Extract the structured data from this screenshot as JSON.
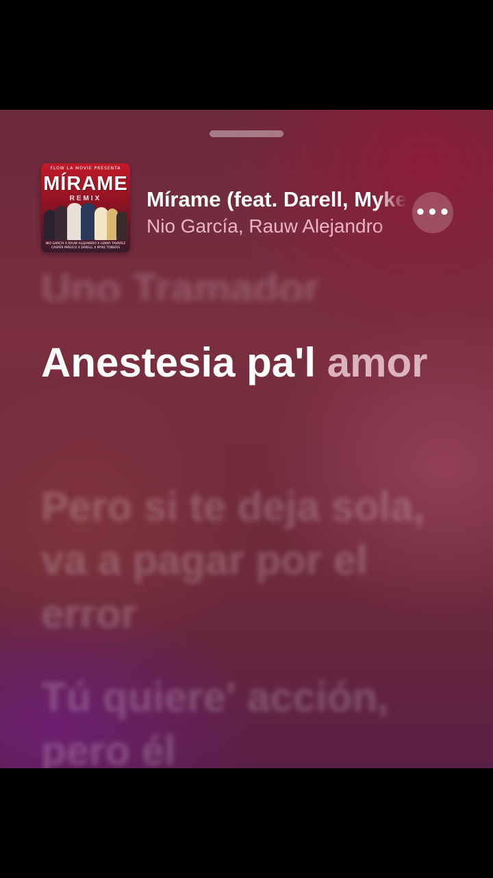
{
  "now_playing": {
    "title": "Mírame (feat. Darell, Myke Towers)",
    "artist": "Nio García, Rauw Alejandro",
    "artwork": {
      "top_line": "FLOW LA MOVIE PRESENTA",
      "title": "MÍRAME",
      "subtitle": "REMIX",
      "credits": "NIO GARCÍA X RAUW ALEJANDRO X LENNY TAVÁREZ CASPER MÁGICO X DARELL X MYKE TOWERS"
    },
    "more_icon": "ellipsis-icon",
    "more_glyph": "•••"
  },
  "lyrics": {
    "previous": "Uno Tramador",
    "current_sung": "Anestesia pa'l",
    "current_pending": "amor",
    "next": "Pero si te deja sola, va a pagar por el error",
    "next2": "Tú quiere' acción, pero él"
  },
  "colors": {
    "background": "#6e2a3a",
    "accent": "#c41a2a"
  }
}
